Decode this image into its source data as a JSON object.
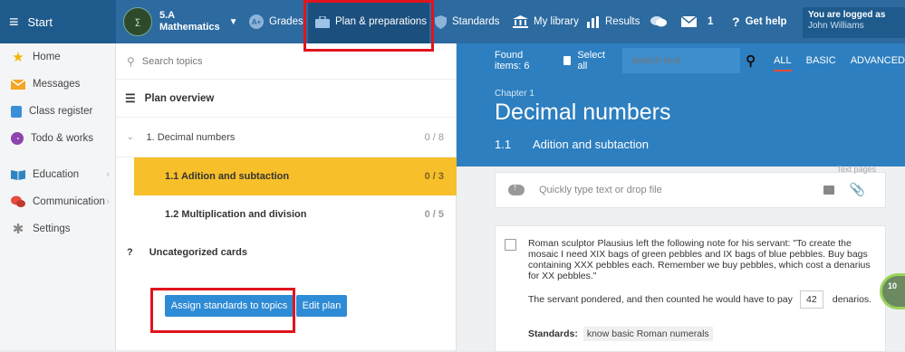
{
  "topbar": {
    "start_label": "Start",
    "class_name": "5.A",
    "subject": "Mathematics",
    "nav": [
      {
        "label": "Grades"
      },
      {
        "label": "Plan & preparations"
      },
      {
        "label": "Standards"
      },
      {
        "label": "My library"
      },
      {
        "label": "Results"
      },
      {
        "label": ""
      },
      {
        "label": "1"
      },
      {
        "label": "Get help"
      }
    ],
    "logged_in": "You are logged as",
    "user_name": "John Williams"
  },
  "sidebar": {
    "items": [
      {
        "label": "Home"
      },
      {
        "label": "Messages"
      },
      {
        "label": "Class register"
      },
      {
        "label": "Todo & works"
      },
      {
        "label": "Education"
      },
      {
        "label": "Communication"
      },
      {
        "label": "Settings"
      }
    ]
  },
  "middle": {
    "search_placeholder": "Search topics",
    "plan_title": "Plan overview",
    "topic": {
      "label": "1. Decimal numbers",
      "count": "0 / 8"
    },
    "subtopics": [
      {
        "label": "1.1 Adition and subtaction",
        "count": "0 / 3"
      },
      {
        "label": "1.2 Multiplication and division",
        "count": "0 / 5"
      }
    ],
    "uncategorized_icon": "?",
    "uncategorized": "Uncategorized cards",
    "assign_btn": "Assign standards to topics",
    "edit_btn": "Edit plan"
  },
  "right": {
    "found": "Found items: 6",
    "select_all": "Select all",
    "search_placeholder": "search text",
    "filters": [
      "ALL",
      "BASIC",
      "ADVANCED"
    ],
    "chapter_label": "Chapter 1",
    "chapter_title": "Decimal numbers",
    "section_num": "1.1",
    "section_title": "Adition and subtaction",
    "upload_text": "Quickly type text or drop file",
    "text_pages": "Text pages",
    "card": {
      "text": "Roman sculptor Plausius left the following note for his servant: \"To create the mosaic I need XIX bags of green pebbles and IX bags of blue pebbles. Buy bags containing XXX pebbles each. Remember we buy pebbles, which cost a denarius for XX pebbles.\"",
      "answer_pre": "The servant pondered, and then counted he would have to pay",
      "answer_value": "42",
      "answer_post": "denarios.",
      "standards_label": "Standards:",
      "standard_tag": "know basic Roman numerals"
    },
    "progress": "10"
  }
}
